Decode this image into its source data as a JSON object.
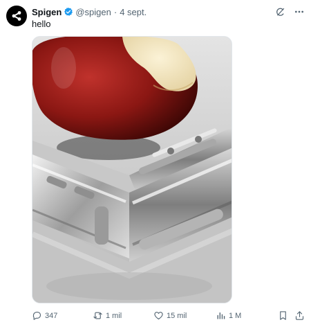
{
  "tweet": {
    "author_name": "Spigen",
    "handle": "@spigen",
    "separator": "·",
    "date": "4 sept.",
    "text": "hello"
  },
  "icons": {
    "avatar": "spigen-logo-icon",
    "verified": "verified-badge-icon",
    "grok": "grok-icon",
    "more": "more-dots-icon",
    "reply": "reply-icon",
    "retweet": "retweet-icon",
    "like": "heart-icon",
    "views": "views-chart-icon",
    "bookmark": "bookmark-icon",
    "share": "share-icon"
  },
  "media": {
    "description_kind": "photo"
  },
  "actions": {
    "replies": "347",
    "retweets": "1 mil",
    "likes": "15 mil",
    "views": "1 M"
  },
  "colors": {
    "verified_blue": "#1d9bf0",
    "text_primary": "#0f1419",
    "text_secondary": "#536471"
  }
}
